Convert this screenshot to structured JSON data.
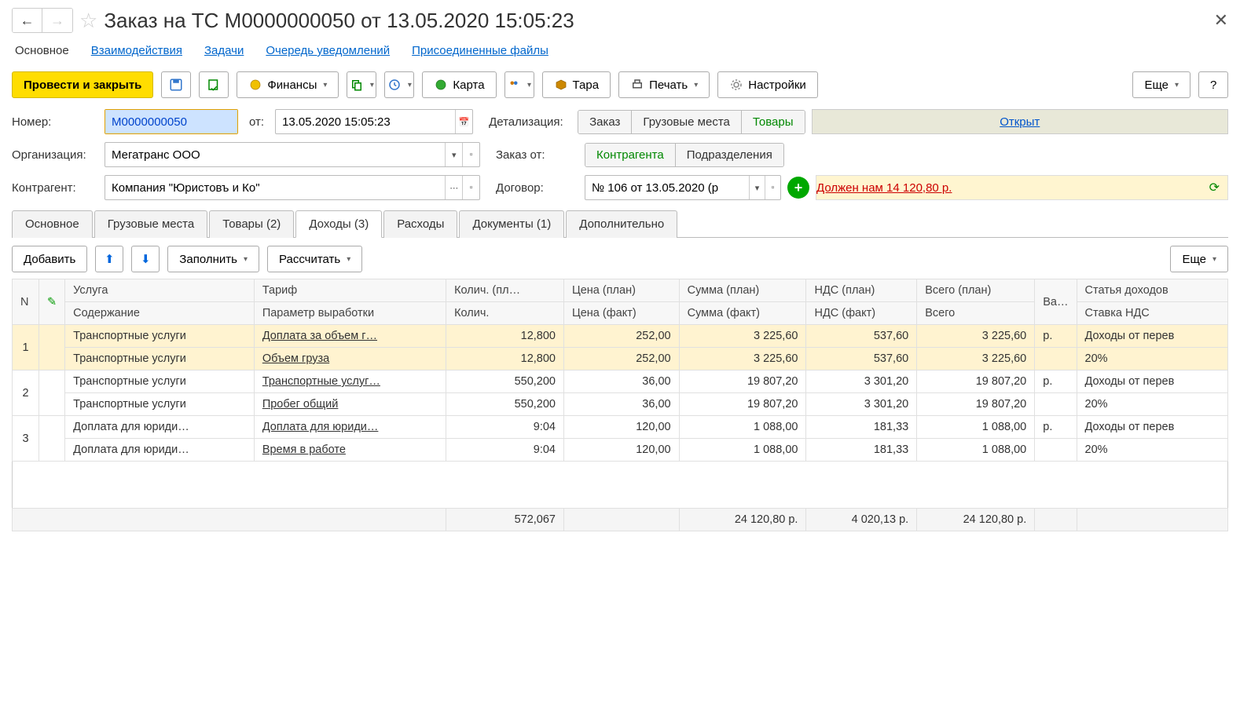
{
  "header": {
    "title": "Заказ на ТС M0000000050 от 13.05.2020 15:05:23"
  },
  "nav": {
    "main": "Основное",
    "interactions": "Взаимодействия",
    "tasks": "Задачи",
    "notif_queue": "Очередь уведомлений",
    "attached": "Присоединенные файлы"
  },
  "toolbar": {
    "post_close": "Провести и закрыть",
    "finances": "Финансы",
    "map": "Карта",
    "tare": "Тара",
    "print": "Печать",
    "settings": "Настройки",
    "more": "Еще",
    "help": "?"
  },
  "fields": {
    "number_label": "Номер:",
    "number_value": "M0000000050",
    "from_label": "от:",
    "date_value": "13.05.2020 15:05:23",
    "detail_label": "Детализация:",
    "detail_order": "Заказ",
    "detail_cargo": "Грузовые места",
    "detail_goods": "Товары",
    "status_open": "Открыт",
    "org_label": "Организация:",
    "org_value": "Мегатранс ООО",
    "order_from_label": "Заказ от:",
    "order_from_contr": "Контрагента",
    "order_from_dept": "Подразделения",
    "contr_label": "Контрагент:",
    "contr_value": "Компания \"Юристовъ и Ко\"",
    "contract_label": "Договор:",
    "contract_value": "№ 106 от 13.05.2020 (р",
    "debt_text": "Должен нам 14 120,80 р."
  },
  "tabs": {
    "main": "Основное",
    "cargo": "Грузовые места",
    "goods": "Товары (2)",
    "income": "Доходы (3)",
    "expense": "Расходы",
    "docs": "Документы (1)",
    "extra": "Дополнительно"
  },
  "subtb": {
    "add": "Добавить",
    "fill": "Заполнить",
    "calc": "Рассчитать",
    "more": "Еще"
  },
  "grid": {
    "h_n": "N",
    "h_service": "Услуга",
    "h_content": "Содержание",
    "h_tariff": "Тариф",
    "h_param": "Параметр выработки",
    "h_qty_plan": "Колич. (пл…",
    "h_qty": "Колич.",
    "h_price_plan": "Цена (план)",
    "h_price_fact": "Цена (факт)",
    "h_sum_plan": "Сумма (план)",
    "h_sum_fact": "Сумма (факт)",
    "h_vat_plan": "НДС (план)",
    "h_vat_fact": "НДС (факт)",
    "h_total_plan": "Всего (план)",
    "h_total": "Всего",
    "h_cur": "Ва…",
    "h_article": "Статья доходов",
    "h_vat_rate": "Ставка НДС"
  },
  "rows": [
    {
      "n": "1",
      "svc": "Транспортные услуги",
      "svc2": "Транспортные услуги",
      "tariff": "Доплата за объем г…",
      "param": "Объем груза",
      "qty": "12,800",
      "qty2": "12,800",
      "price": "252,00",
      "price2": "252,00",
      "sum": "3 225,60",
      "sum2": "3 225,60",
      "vat": "537,60",
      "vat2": "537,60",
      "tot": "3 225,60",
      "tot2": "3 225,60",
      "cur": "р.",
      "art": "Доходы от перев",
      "rate": "20%"
    },
    {
      "n": "2",
      "svc": "Транспортные услуги",
      "svc2": "Транспортные услуги",
      "tariff": "Транспортные услуг…",
      "param": "Пробег общий",
      "qty": "550,200",
      "qty2": "550,200",
      "price": "36,00",
      "price2": "36,00",
      "sum": "19 807,20",
      "sum2": "19 807,20",
      "vat": "3 301,20",
      "vat2": "3 301,20",
      "tot": "19 807,20",
      "tot2": "19 807,20",
      "cur": "р.",
      "art": "Доходы от перев",
      "rate": "20%"
    },
    {
      "n": "3",
      "svc": "Доплата для юриди…",
      "svc2": "Доплата для юриди…",
      "tariff": "Доплата для юриди…",
      "param": "Время в работе",
      "qty": "9:04",
      "qty2": "9:04",
      "price": "120,00",
      "price2": "120,00",
      "sum": "1 088,00",
      "sum2": "1 088,00",
      "vat": "181,33",
      "vat2": "181,33",
      "tot": "1 088,00",
      "tot2": "1 088,00",
      "cur": "р.",
      "art": "Доходы от перев",
      "rate": "20%"
    }
  ],
  "footer": {
    "qty": "572,067",
    "sum": "24 120,80 р.",
    "vat": "4 020,13 р.",
    "tot": "24 120,80 р."
  }
}
